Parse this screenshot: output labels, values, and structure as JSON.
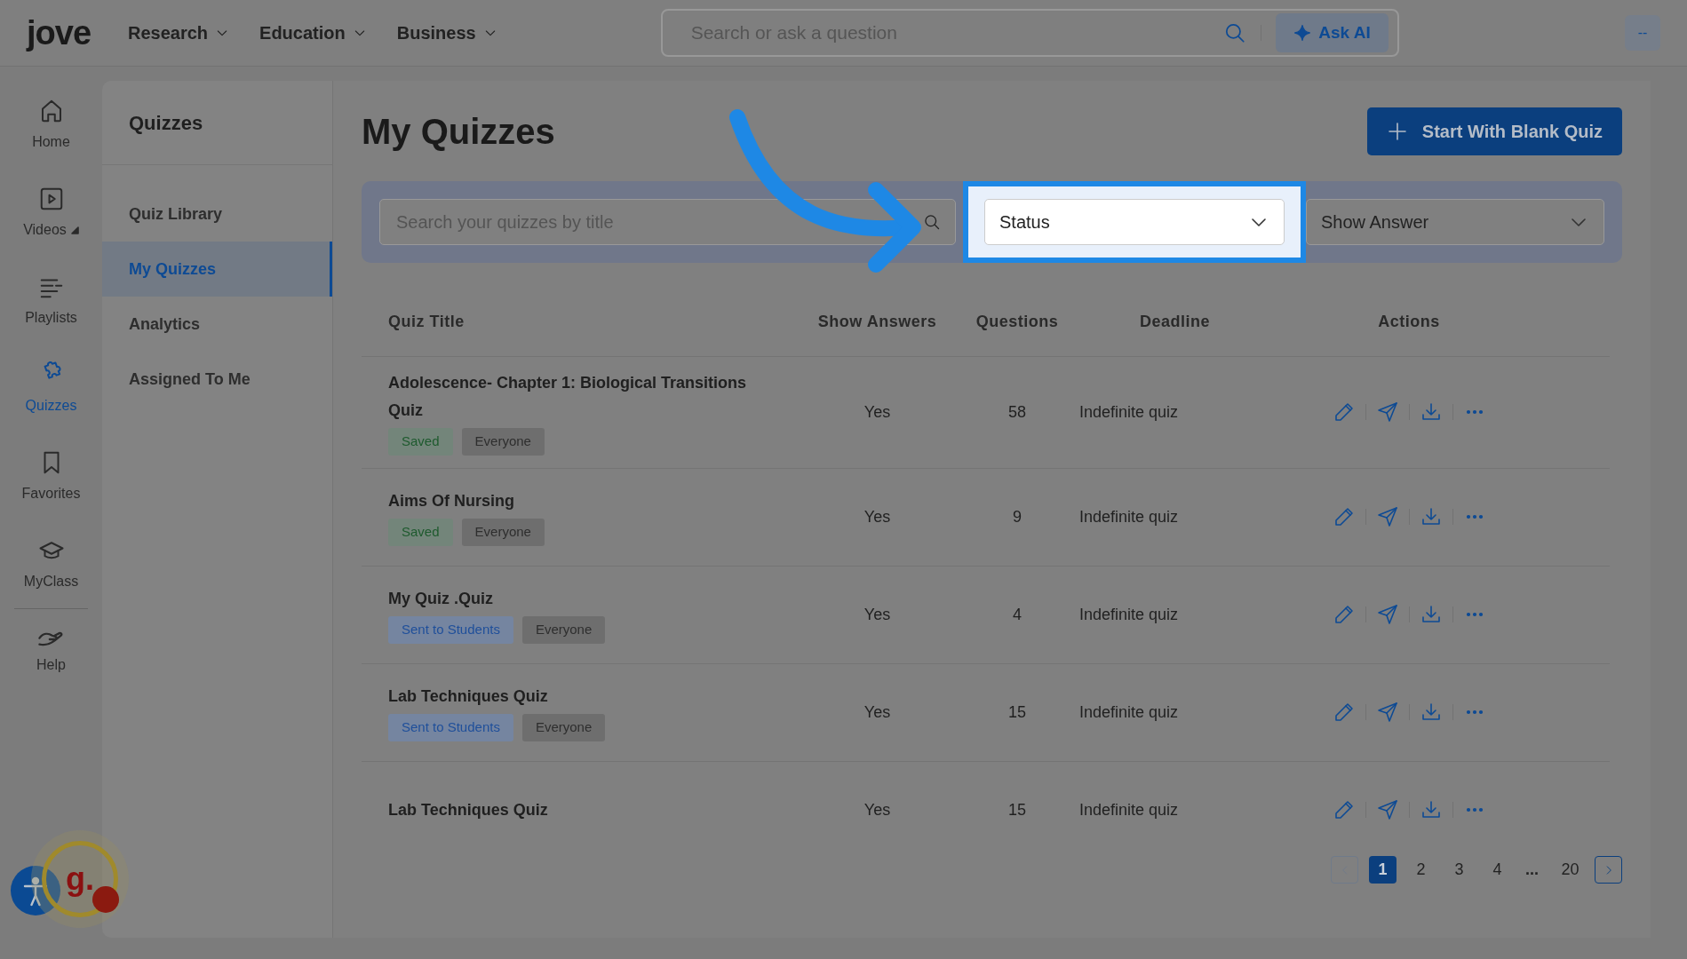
{
  "header": {
    "logo": "jove",
    "menus": [
      {
        "label": "Research"
      },
      {
        "label": "Education"
      },
      {
        "label": "Business"
      }
    ],
    "search": {
      "placeholder": "Search or ask a question"
    },
    "ask_ai": "Ask AI",
    "user_button": "--"
  },
  "rail": [
    {
      "label": "Home",
      "selected": false,
      "has_caret": false
    },
    {
      "label": "Videos",
      "selected": false,
      "has_caret": true
    },
    {
      "label": "Playlists",
      "selected": false,
      "has_caret": false
    },
    {
      "label": "Quizzes",
      "selected": true,
      "has_caret": false
    },
    {
      "label": "Favorites",
      "selected": false,
      "has_caret": false
    },
    {
      "label": "MyClass",
      "selected": false,
      "has_caret": false
    },
    {
      "label": "Help",
      "selected": false,
      "has_caret": false
    }
  ],
  "sidebar": {
    "title": "Quizzes",
    "items": [
      {
        "label": "Quiz Library",
        "selected": false
      },
      {
        "label": "My Quizzes",
        "selected": true
      },
      {
        "label": "Analytics",
        "selected": false
      },
      {
        "label": "Assigned To Me",
        "selected": false
      }
    ]
  },
  "page": {
    "title": "My Quizzes",
    "new_button": "Start With Blank Quiz"
  },
  "filters": {
    "search": {
      "placeholder": "Search your quizzes by title"
    },
    "status": {
      "value": "Status",
      "highlighted": true
    },
    "show_answer": {
      "value": "Show Answer"
    }
  },
  "table": {
    "columns": [
      "Quiz Title",
      "Show Answers",
      "Questions",
      "Deadline",
      "Actions"
    ],
    "rows": [
      {
        "title": "Adolescence- Chapter 1: Biological Transitions Quiz",
        "tags": [
          {
            "label": "Saved",
            "kind": "saved"
          },
          {
            "label": "Everyone",
            "kind": "audience"
          }
        ],
        "show_answers": "Yes",
        "questions": "58",
        "deadline": "Indefinite quiz"
      },
      {
        "title": "Aims Of Nursing",
        "tags": [
          {
            "label": "Saved",
            "kind": "saved"
          },
          {
            "label": "Everyone",
            "kind": "audience"
          }
        ],
        "show_answers": "Yes",
        "questions": "9",
        "deadline": "Indefinite quiz"
      },
      {
        "title": "My Quiz .Quiz",
        "tags": [
          {
            "label": "Sent to Students",
            "kind": "sent"
          },
          {
            "label": "Everyone",
            "kind": "audience"
          }
        ],
        "show_answers": "Yes",
        "questions": "4",
        "deadline": "Indefinite quiz"
      },
      {
        "title": "Lab Techniques Quiz",
        "tags": [
          {
            "label": "Sent to Students",
            "kind": "sent"
          },
          {
            "label": "Everyone",
            "kind": "audience"
          }
        ],
        "show_answers": "Yes",
        "questions": "15",
        "deadline": "Indefinite quiz"
      },
      {
        "title": "Lab Techniques Quiz",
        "show_answers": "Yes",
        "questions": "15",
        "deadline": "Indefinite quiz"
      }
    ]
  },
  "pagination": {
    "prev_disabled": true,
    "next_disabled": false,
    "pages": [
      {
        "label": "1",
        "kind": "page",
        "selected": true
      },
      {
        "label": "2",
        "kind": "page",
        "selected": false
      },
      {
        "label": "3",
        "kind": "page",
        "selected": false
      },
      {
        "label": "4",
        "kind": "page",
        "selected": false
      },
      {
        "label": "...",
        "kind": "ellipsis"
      },
      {
        "label": "20",
        "kind": "page",
        "selected": false
      }
    ]
  },
  "widgets": {
    "assistant_badge": "g."
  }
}
